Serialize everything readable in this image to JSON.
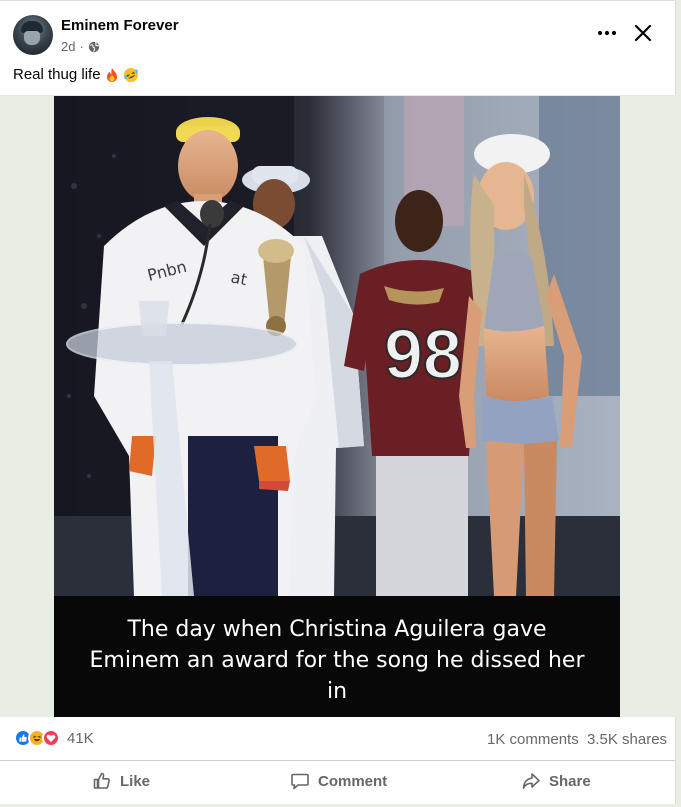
{
  "post": {
    "page_name": "Eminem Forever",
    "time": "2d",
    "audience_icon": "globe-icon",
    "caption_text": "Real thug life",
    "caption_emojis": [
      "fire-emoji",
      "rofl-emoji"
    ],
    "more_icon": "more-horizontal-icon",
    "close_icon": "close-icon"
  },
  "image": {
    "caption_lines": [
      "The day when Christina Aguilera gave",
      "Eminem an award for the song he dissed her",
      "in"
    ],
    "jersey_number": "98"
  },
  "stats": {
    "reactions": [
      "like-reaction-icon",
      "haha-reaction-icon",
      "love-reaction-icon"
    ],
    "reaction_count": "41K",
    "comments": "1K comments",
    "shares": "3.5K shares"
  },
  "actions": {
    "like": "Like",
    "comment": "Comment",
    "share": "Share"
  },
  "colors": {
    "facebook_blue": "#1877f2",
    "secondary_text": "#65676b",
    "background": "#e9eee4"
  }
}
